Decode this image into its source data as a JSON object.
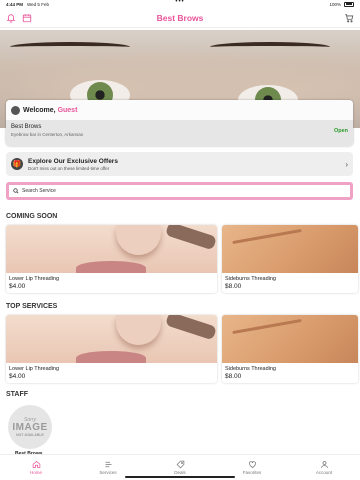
{
  "status": {
    "time": "4:44 PM",
    "date": "Wed 5 Feb",
    "battery": "100%"
  },
  "header": {
    "title": "Best Brows"
  },
  "welcome": {
    "greeting": "Welcome,",
    "user": "Guest"
  },
  "business": {
    "name": "Best Brows",
    "subtitle": "Eyebrow bar in Centerton, Arkansas",
    "status": "Open"
  },
  "offers": {
    "title": "Explore Our Exclusive Offers",
    "subtitle": "Don't miss out on these limited-time offer"
  },
  "search": {
    "placeholder": "Search Service"
  },
  "coming_soon": {
    "title": "COMING SOON",
    "items": [
      {
        "name": "Lower Lip Threading",
        "price": "$4.00"
      },
      {
        "name": "Sideburns Threading",
        "price": "$8.00"
      }
    ]
  },
  "top_services": {
    "title": "TOP SERVICES",
    "items": [
      {
        "name": "Lower Lip Threading",
        "price": "$4.00"
      },
      {
        "name": "Sideburns Threading",
        "price": "$8.00"
      }
    ]
  },
  "staff": {
    "title": "STAFF",
    "placeholder": {
      "line1": "Sorry",
      "line2": "IMAGE",
      "line3": "NOT AVAILABLE"
    },
    "members": [
      {
        "name": "Best Brows"
      }
    ]
  },
  "tabs": [
    {
      "label": "Home",
      "icon": "home-icon",
      "active": true
    },
    {
      "label": "Services",
      "icon": "services-icon"
    },
    {
      "label": "Deals",
      "icon": "deals-icon"
    },
    {
      "label": "Favorites",
      "icon": "heart-icon"
    },
    {
      "label": "Account",
      "icon": "account-icon"
    }
  ],
  "colors": {
    "brand": "#e8549a",
    "open": "#2a9a2a",
    "search_border": "#f0a2c6"
  }
}
